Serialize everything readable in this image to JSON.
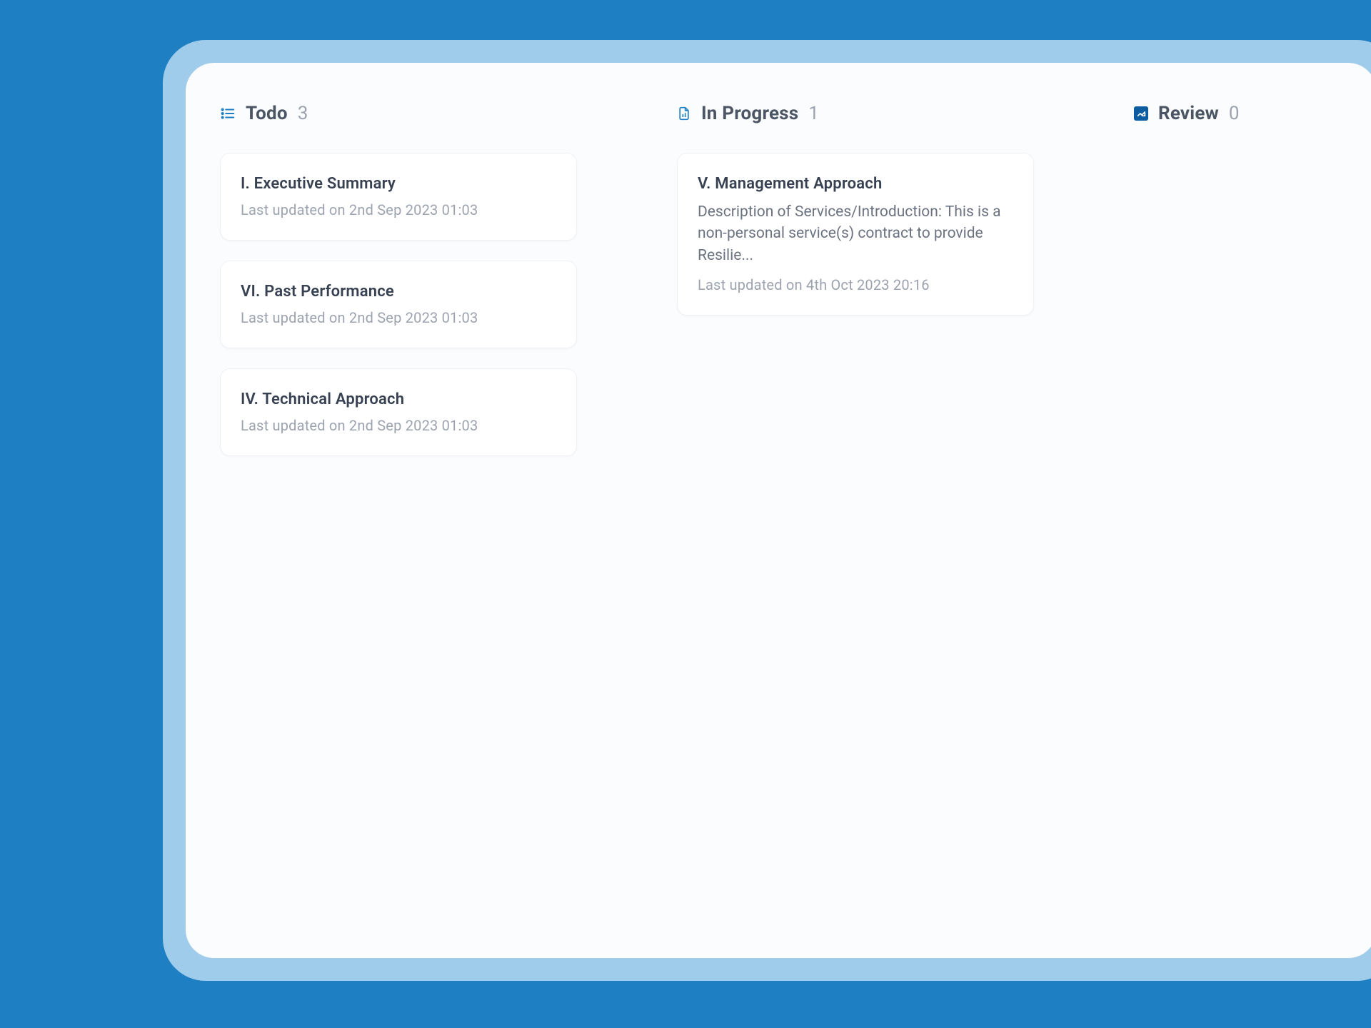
{
  "columns": {
    "todo": {
      "title": "Todo",
      "count": "3",
      "items": [
        {
          "title": "I. Executive Summary",
          "meta": "Last updated on 2nd Sep 2023 01:03"
        },
        {
          "title": "VI. Past Performance",
          "meta": "Last updated on 2nd Sep 2023 01:03"
        },
        {
          "title": "IV. Technical Approach",
          "meta": "Last updated on 2nd Sep 2023 01:03"
        }
      ]
    },
    "in_progress": {
      "title": "In Progress",
      "count": "1",
      "items": [
        {
          "title": "V. Management Approach",
          "body": "Description of Services/Introduction: This is a non-personal service(s) contract to provide Resilie...",
          "meta": "Last updated on 4th Oct 2023 20:16"
        }
      ]
    },
    "review": {
      "title": "Review",
      "count": "0",
      "items": []
    }
  }
}
